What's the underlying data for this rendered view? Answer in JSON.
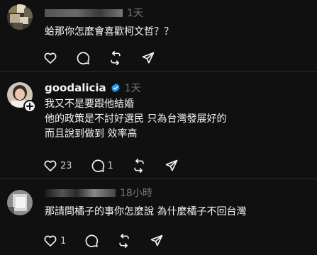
{
  "comments": [
    {
      "timestamp": "1天",
      "text_lines": [
        "蛤那你怎麼會喜歡柯文哲？？"
      ],
      "actions": {
        "like": "",
        "reply": "",
        "repost": "",
        "share": ""
      }
    },
    {
      "username": "goodalicia",
      "verified": true,
      "timestamp": "1天",
      "text_lines": [
        "我又不是要跟他結婚",
        "他的政策是不討好選民 只為台灣發展好的",
        "而且說到做到 效率高"
      ],
      "actions": {
        "like": "23",
        "reply": "1",
        "repost": "",
        "share": ""
      }
    },
    {
      "timestamp": "18小時",
      "text_lines": [
        "那請問橘子的事你怎麼說 為什麼橘子不回台灣"
      ],
      "actions": {
        "like": "1",
        "reply": "",
        "repost": "",
        "share": ""
      }
    }
  ],
  "icons": {
    "like": "heart-icon",
    "reply": "speech-bubble-icon",
    "repost": "repost-icon",
    "share": "send-icon",
    "verified": "verified-badge-icon",
    "follow": "plus-icon"
  },
  "colors": {
    "background": "#101010",
    "text": "#f3f5f7",
    "muted": "#777777",
    "verified": "#1d9bf0"
  }
}
